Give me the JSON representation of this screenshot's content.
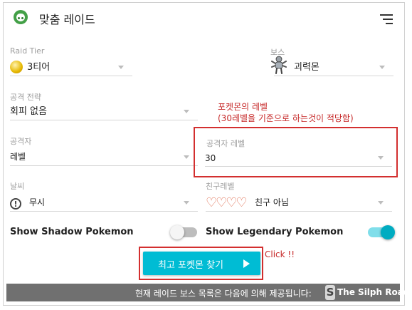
{
  "header": {
    "title": "맞춤 레이드",
    "logo_icon": "pokemon-face-icon",
    "menu_icon": "sort-menu-icon"
  },
  "form": {
    "raid_tier": {
      "label": "Raid Tier",
      "value": "3티어",
      "icon": "raid-egg-icon"
    },
    "boss": {
      "label": "보스",
      "value": "괴력몬",
      "icon": "machamp-sprite-icon"
    },
    "attack_strategy": {
      "label": "공격 전략",
      "value": "회피 없음"
    },
    "attacker": {
      "label": "공격자",
      "value": "레벨"
    },
    "attacker_level": {
      "label": "공격자 레벨",
      "value": "30"
    },
    "weather": {
      "label": "날씨",
      "value": "무시",
      "icon": "warning-icon"
    },
    "friend_level": {
      "label": "친구레벨",
      "value": "친구 아님",
      "hearts": "♡♡♡♡",
      "icon": "hearts-icon"
    }
  },
  "toggles": {
    "shadow": {
      "label": "Show Shadow Pokemon",
      "state": "off"
    },
    "legendary": {
      "label": "Show Legendary Pokemon",
      "state": "on"
    }
  },
  "annotations": {
    "level_note_1": "포켓몬의 레벨",
    "level_note_2": "(30레벨을 기준으로 하는것이 적당함)",
    "click_note": "Click !!"
  },
  "find_button": {
    "label": "최고 포켓몬 찾기",
    "icon": "play-icon"
  },
  "footer": {
    "text": "현재 레이드 보스 목록은 다음에 의해 제공됩니다:",
    "brand": "The Silph Road",
    "brand_logo": "S"
  },
  "colors": {
    "accent": "#00bcd4",
    "annotation_red": "#d32f2f",
    "footer_bg": "#707070",
    "toggle_on": "#00acc1",
    "hearts": "#e07055"
  }
}
